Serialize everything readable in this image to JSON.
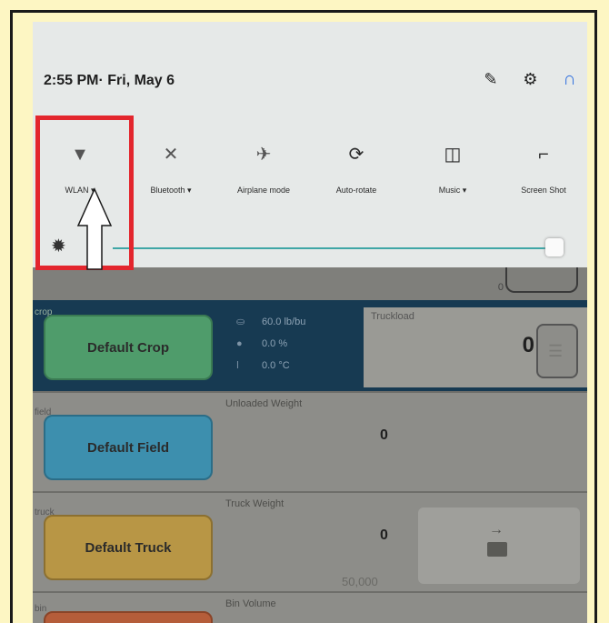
{
  "status": {
    "time": "2:55 PM· Fri, May 6",
    "icons": [
      "edit-icon",
      "gear-icon",
      "user-icon"
    ]
  },
  "quick_tiles": [
    {
      "label": "WLAN ▾",
      "icon": "wifi-off-icon"
    },
    {
      "label": "Bluetooth ▾",
      "icon": "bluetooth-off-icon"
    },
    {
      "label": "Airplane mode",
      "icon": "airplane-off-icon"
    },
    {
      "label": "Auto-rotate",
      "icon": "rotate-icon"
    },
    {
      "label": "Music ▾",
      "icon": "music-icon"
    },
    {
      "label": "Screen Shot",
      "icon": "crop-icon"
    }
  ],
  "brightness": {
    "level_fraction": 0.96
  },
  "app": {
    "top_value": "0",
    "crop": {
      "tag": "crop",
      "name": "Default Crop",
      "stats": [
        {
          "icon": "bushel-icon",
          "value": "60.0 lb/bu"
        },
        {
          "icon": "drop-icon",
          "value": "0.0 %"
        },
        {
          "icon": "thermometer-icon",
          "value": "0.0 °C"
        }
      ],
      "truckload_label": "Truckload",
      "truckload_value": "0"
    },
    "field": {
      "tag": "field",
      "name": "Default Field",
      "label": "Unloaded Weight",
      "value": "0"
    },
    "truck": {
      "tag": "truck",
      "name": "Default Truck",
      "label": "Truck Weight",
      "value": "0",
      "sub": "50,000"
    },
    "bin": {
      "tag": "bin",
      "label": "Bin Volume"
    }
  },
  "colors": {
    "highlight": "#e3262d",
    "accent": "#3fa6a6",
    "user_icon": "#2f6fde",
    "frame_bg": "#fdf6c3"
  }
}
